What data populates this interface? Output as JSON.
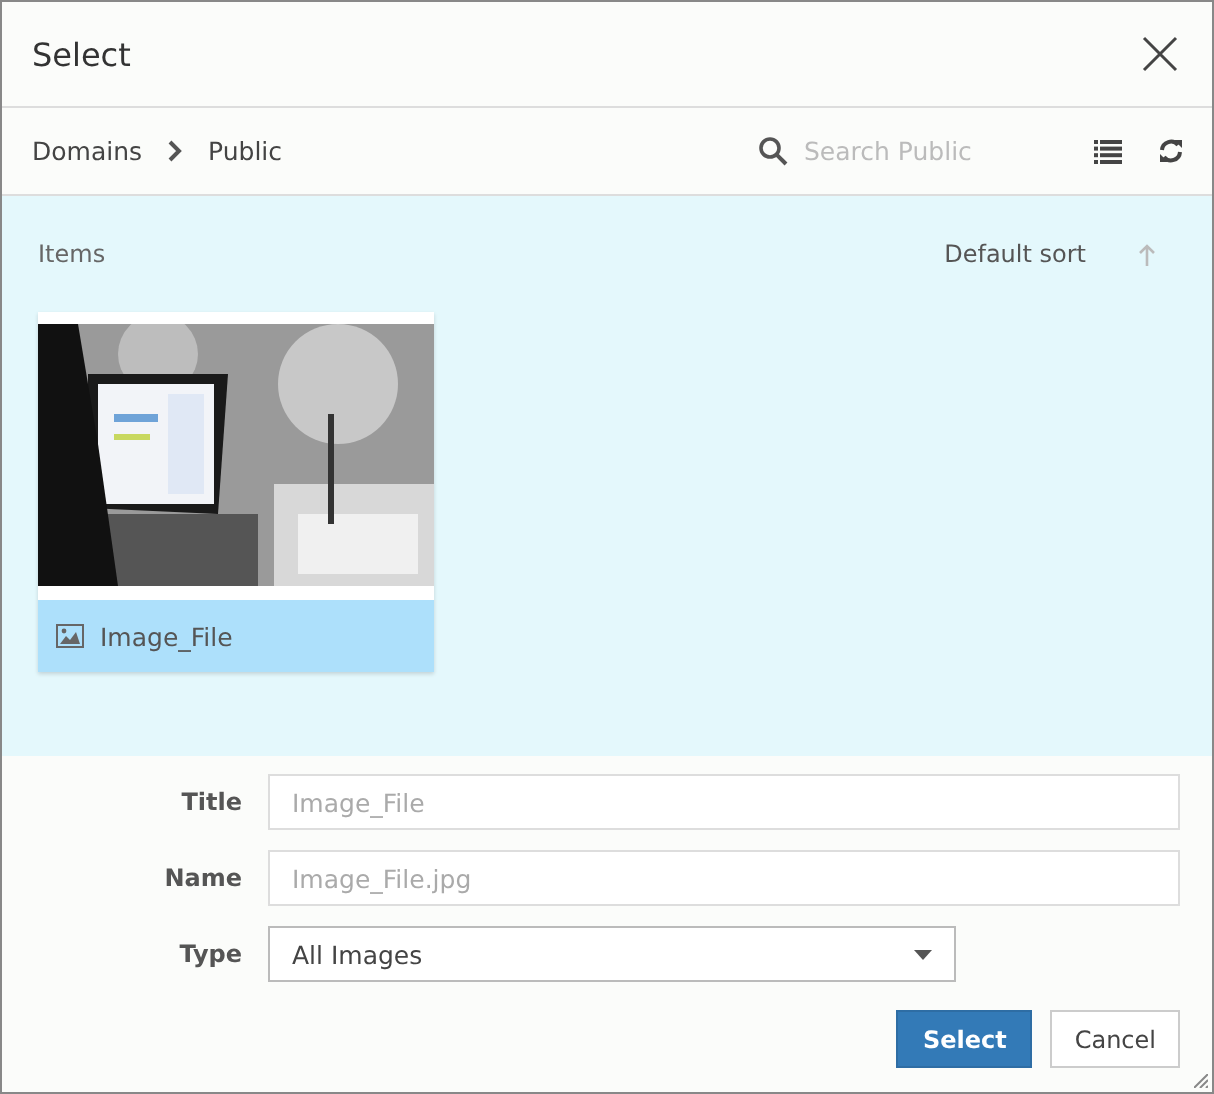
{
  "window": {
    "title": "Select"
  },
  "breadcrumb": [
    "Domains",
    "Public"
  ],
  "search": {
    "placeholder": "Search Public"
  },
  "items_panel": {
    "heading": "Items",
    "sort": "Default sort",
    "items": [
      {
        "kind": "picture",
        "label": "Image_File",
        "selected": true
      }
    ]
  },
  "form": [
    {
      "label": "Title",
      "kind": "text",
      "placeholder": "Image_File"
    },
    {
      "label": "Name",
      "kind": "text",
      "placeholder": "Image_File.jpg"
    },
    {
      "label": "Type",
      "kind": "select",
      "value": "All Images"
    }
  ],
  "buttons": [
    {
      "label": "Select",
      "primary": true
    },
    {
      "label": "Cancel",
      "primary": false
    }
  ]
}
